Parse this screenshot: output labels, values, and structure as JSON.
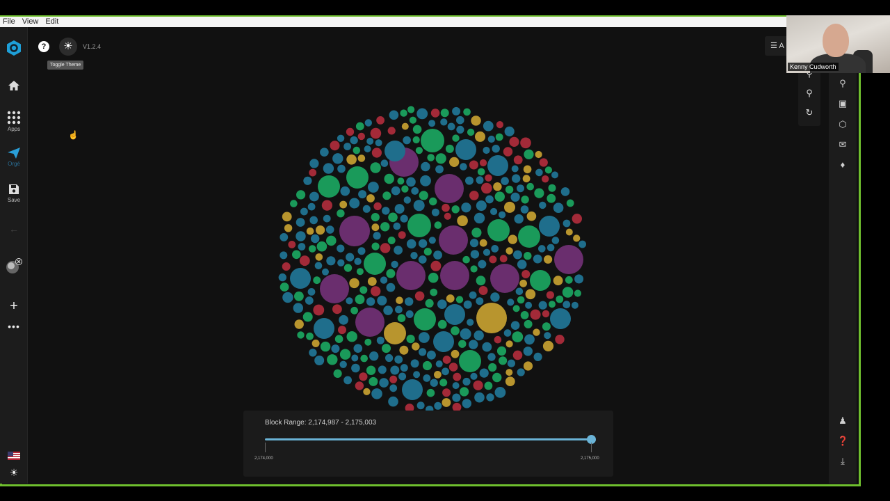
{
  "menu": {
    "file": "File",
    "view": "View",
    "edit": "Edit"
  },
  "left_rail": {
    "apps_label": "Apps",
    "send_label": "Orgé",
    "save_label": "Save"
  },
  "header": {
    "version": "V1.2.4",
    "tooltip": "Toggle Theme"
  },
  "right_panel_button": "A",
  "range": {
    "label": "Block Range: 2,174,987 - 2,175,003",
    "min_label": "2,174,000",
    "max_label": "2,175,000"
  },
  "video": {
    "name": "Kenny Cudworth"
  },
  "icons": {
    "logo": "hex-logo-icon",
    "home": "home-icon",
    "apps": "apps-grid-icon",
    "send": "send-icon",
    "save": "save-icon",
    "back": "back-arrow-icon",
    "plus": "plus-icon",
    "more": "more-dots-icon",
    "flag": "us-flag-icon",
    "sun": "sun-icon",
    "help": "help-icon",
    "zoom_in": "zoom-in-icon",
    "zoom_out": "zoom-out-icon",
    "reset": "reset-icon",
    "people_search": "people-search-icon",
    "wallet": "wallet-icon",
    "shield": "shield-icon",
    "mail": "mail-icon",
    "bell": "bell-icon",
    "user_help": "user-help-icon",
    "question": "question-icon",
    "download": "download-icon"
  },
  "colors": {
    "accent": "#6fbf2e",
    "bubble_blue": "#1f6e8c",
    "bubble_green": "#1a9a5a",
    "bubble_gold": "#b8952e",
    "bubble_purple": "#6a2e6e",
    "bubble_red": "#a32a38",
    "slider": "#6ab3d6"
  }
}
